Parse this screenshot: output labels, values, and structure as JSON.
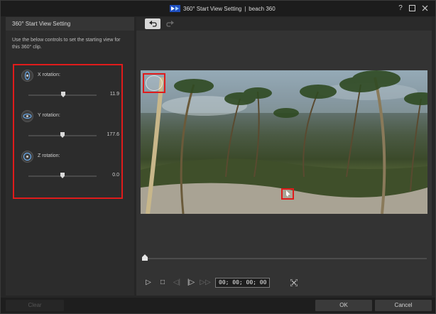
{
  "window": {
    "title": "360° Start View Setting",
    "separator": "|",
    "project": "beach 360",
    "help_icon": "question-mark-icon",
    "maximize_icon": "maximize-icon",
    "close_icon": "close-icon"
  },
  "left_panel": {
    "header": "360° Start View Setting",
    "description": "Use the below controls to set the starting view for this 360° clip.",
    "rotations": [
      {
        "label": "X rotation:",
        "value": "11.9",
        "position": 0.52
      },
      {
        "label": "Y rotation:",
        "value": "177.6",
        "position": 0.5
      },
      {
        "label": "Z rotation:",
        "value": "0.0",
        "position": 0.5
      }
    ]
  },
  "toolbar": {
    "undo_icon": "undo-icon",
    "redo_icon": "redo-icon"
  },
  "player": {
    "timecode": "00; 00; 00; 00",
    "timeline_position": 0.0
  },
  "buttons": {
    "clear": "Clear",
    "ok": "OK",
    "cancel": "Cancel"
  },
  "colors": {
    "highlight": "#e01b1b",
    "panel_bg": "#2c2c2c",
    "window_bg": "#262626"
  }
}
